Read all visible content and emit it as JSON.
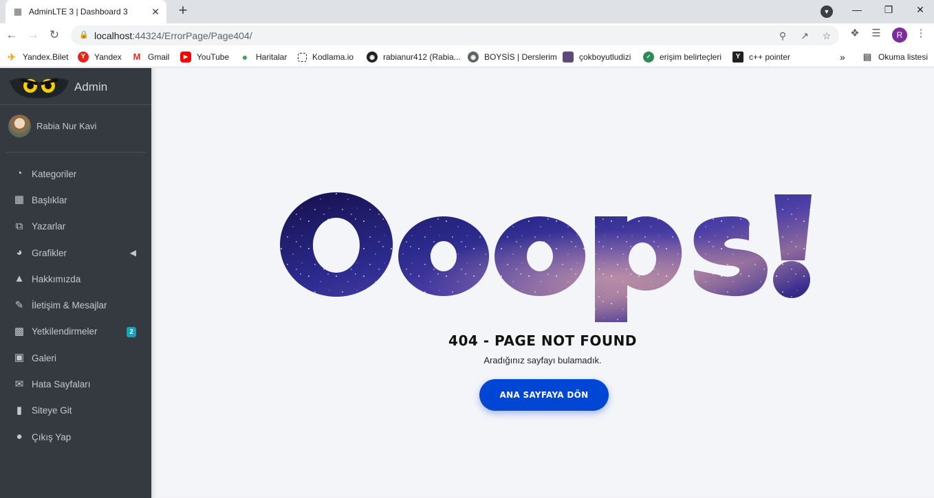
{
  "browser": {
    "tab_title": "AdminLTE 3 | Dashboard 3",
    "url_host": "localhost",
    "url_rest": ":44324/ErrorPage/Page404/",
    "bookmarks": [
      {
        "label": "Yandex.Bilet",
        "icon": "plane-icon",
        "color": "#f5a623"
      },
      {
        "label": "Yandex",
        "icon": "yandex-icon",
        "color": "#e8231a"
      },
      {
        "label": "Gmail",
        "icon": "gmail-icon",
        "color": "#d93025"
      },
      {
        "label": "YouTube",
        "icon": "youtube-icon",
        "color": "#ff0000"
      },
      {
        "label": "Haritalar",
        "icon": "maps-pin-icon",
        "color": "#34a853"
      },
      {
        "label": "Kodlama.io",
        "icon": "kodlama-icon",
        "color": "#202124"
      },
      {
        "label": "rabianur412 (Rabia...",
        "icon": "github-icon",
        "color": "#202124"
      },
      {
        "label": "BOYSİS | Derslerim",
        "icon": "globe-icon",
        "color": "#5f6368"
      },
      {
        "label": "çokboyutludizi",
        "icon": "bookmark-site-icon",
        "color": "#5b4a7a"
      },
      {
        "label": "erişim belirteçleri",
        "icon": "shield-site-icon",
        "color": "#2e8b57"
      },
      {
        "label": "c++ pointer",
        "icon": "ycombinator-icon",
        "color": "#202124"
      }
    ],
    "reading_list": "Okuma listesi",
    "profile_initial": "R"
  },
  "sidebar": {
    "brand": "Admin",
    "user_name": "Rabia Nur Kavi",
    "items": [
      {
        "label": "Kategoriler",
        "icon": "dashboard-gauge-icon"
      },
      {
        "label": "Başlıklar",
        "icon": "grid-icon"
      },
      {
        "label": "Yazarlar",
        "icon": "copy-icon"
      },
      {
        "label": "Grafikler",
        "icon": "pie-chart-icon"
      },
      {
        "label": "Hakkımızda",
        "icon": "tree-icon"
      },
      {
        "label": "İletişim & Mesajlar",
        "icon": "edit-icon"
      },
      {
        "label": "Yetkilendirmeler",
        "icon": "calendar-icon",
        "badge": "2"
      },
      {
        "label": "Galeri",
        "icon": "image-icon"
      },
      {
        "label": "Hata Sayfaları",
        "icon": "envelope-icon"
      },
      {
        "label": "Siteye Git",
        "icon": "book-icon"
      },
      {
        "label": "Çıkış Yap",
        "icon": "apple-icon"
      }
    ]
  },
  "error_page": {
    "headline": "Ooops!",
    "title": "404 - PAGE NOT FOUND",
    "subtitle": "Aradığınız sayfayı bulamadık.",
    "button": "ANA SAYFAYA DÖN",
    "button_color": "#0046d5"
  }
}
